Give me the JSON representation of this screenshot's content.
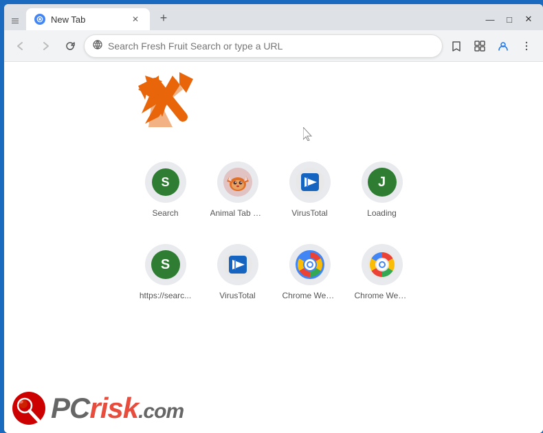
{
  "window": {
    "title": "New Tab",
    "controls": {
      "minimize": "—",
      "maximize": "□",
      "close": "✕"
    }
  },
  "tabs": [
    {
      "label": "New Tab",
      "active": true
    }
  ],
  "addressBar": {
    "placeholder": "Search Fresh Fruit Search or type a URL",
    "value": "Search Fresh Fruit Search or type a URL"
  },
  "shortcuts": [
    {
      "id": "search",
      "label": "Search",
      "type": "letter-s-green"
    },
    {
      "id": "animal-tab",
      "label": "Animal Tab N...",
      "type": "animal-fox"
    },
    {
      "id": "virustotal-1",
      "label": "VirusTotal",
      "type": "vt-arrow"
    },
    {
      "id": "loading",
      "label": "Loading",
      "type": "letter-j-green"
    },
    {
      "id": "https-search",
      "label": "https://searc...",
      "type": "letter-s-green"
    },
    {
      "id": "virustotal-2",
      "label": "VirusTotal",
      "type": "vt-arrow"
    },
    {
      "id": "chrome-web-1",
      "label": "Chrome Web...",
      "type": "chrome-rainbow"
    },
    {
      "id": "chrome-web-2",
      "label": "Chrome Web...",
      "type": "chrome-rainbow"
    }
  ],
  "watermark": {
    "text_pc": "PC",
    "text_risk": "risk",
    "text_domain": ".com"
  }
}
